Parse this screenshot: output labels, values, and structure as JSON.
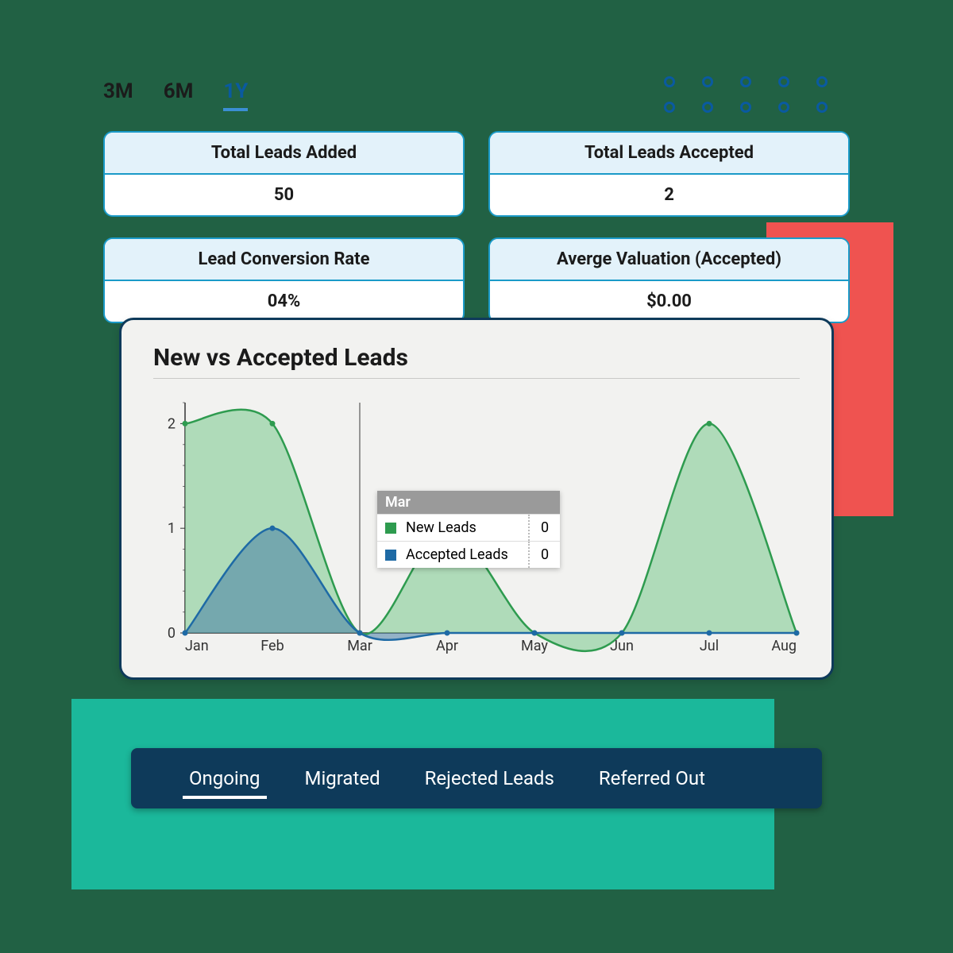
{
  "range_tabs": [
    "3M",
    "6M",
    "1Y"
  ],
  "range_active": 2,
  "metrics": [
    {
      "label": "Total Leads Added",
      "value": "50"
    },
    {
      "label": "Total Leads Accepted",
      "value": "2"
    },
    {
      "label": "Lead Conversion Rate",
      "value": "04%"
    },
    {
      "label": "Averge Valuation (Accepted)",
      "value": "$0.00"
    }
  ],
  "chart_title": "New vs Accepted Leads",
  "chart_data": {
    "type": "area",
    "categories": [
      "Jan",
      "Feb",
      "Mar",
      "Apr",
      "May",
      "Jun",
      "Jul",
      "Aug"
    ],
    "y_ticks": [
      0,
      1,
      2
    ],
    "series": [
      {
        "name": "New Leads",
        "color": "#2e9b4f",
        "fill": "rgba(120,200,140,0.55)",
        "values": [
          2,
          2,
          0,
          1,
          0,
          0,
          2,
          0
        ]
      },
      {
        "name": "Accepted Leads",
        "color": "#1e6aa5",
        "fill": "rgba(70,125,165,0.55)",
        "values": [
          0,
          1,
          0,
          0,
          0,
          0,
          0,
          0
        ]
      }
    ],
    "ylim": [
      0,
      2.2
    ]
  },
  "tooltip": {
    "category": "Mar",
    "rows": [
      {
        "swatch": "#2e9b4f",
        "label": "New Leads",
        "value": "0"
      },
      {
        "swatch": "#1e6aa5",
        "label": "Accepted Leads",
        "value": "0"
      }
    ]
  },
  "tabs": [
    "Ongoing",
    "Migrated",
    "Rejected Leads",
    "Referred Out"
  ],
  "tabs_active": 0
}
